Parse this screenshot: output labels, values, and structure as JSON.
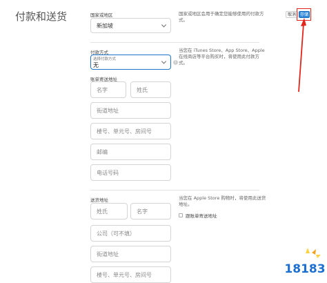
{
  "page": {
    "title": "付款和送货"
  },
  "actions": {
    "cancel_label": "取消",
    "save_label": "存储"
  },
  "region": {
    "label": "国家或地区",
    "value": "新加坡",
    "help": "国家或地区会用于确定您能够使用的付款方式。"
  },
  "payment": {
    "label": "付款方式",
    "select_hint": "选择付款方式",
    "value": "无",
    "help": "当您在 iTunes Store、App Store、Apple 在线商店等平台购买时，将使用此付款方式。"
  },
  "billing": {
    "label": "账单寄送地址",
    "first_name_placeholder": "名字",
    "last_name_placeholder": "姓氏",
    "street_placeholder": "街道地址",
    "unit_placeholder": "楼号、单元号、房间号",
    "postal_placeholder": "邮编",
    "phone_placeholder": "电话号码"
  },
  "shipping": {
    "label": "送货地址",
    "last_name_placeholder": "姓氏",
    "first_name_placeholder": "名字",
    "company_placeholder": "公司（可不填）",
    "street_placeholder": "街道地址",
    "unit_placeholder": "楼号、单元号、房间号",
    "help": "当您在 Apple Store 购物时，将使用此送货地址。",
    "same_address_label": "跟账单寄送地址"
  },
  "annotation": {
    "color": "#e2241b"
  },
  "watermark": {
    "text": "18183",
    "colors": [
      "#1c6fd1",
      "#f0a21c",
      "#ffd23f"
    ]
  }
}
